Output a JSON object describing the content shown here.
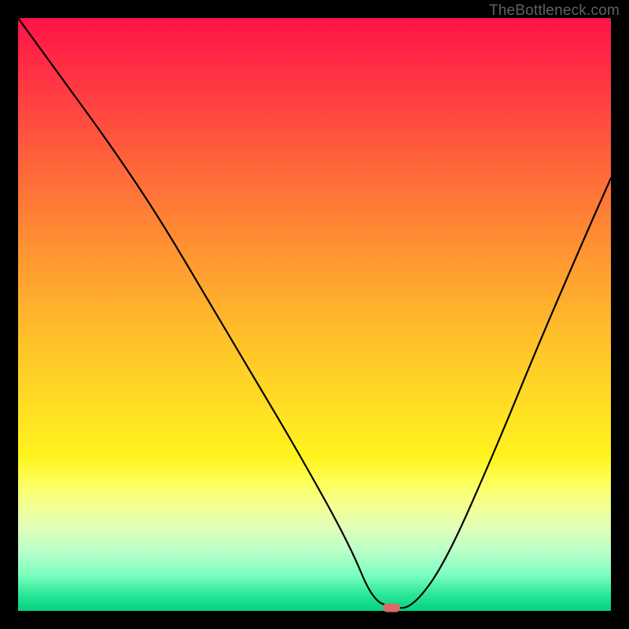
{
  "watermark": "TheBottleneck.com",
  "marker": {
    "x_frac": 0.63,
    "y_frac": 0.995
  },
  "chart_data": {
    "type": "line",
    "title": "",
    "xlabel": "",
    "ylabel": "",
    "xlim": [
      0,
      1
    ],
    "ylim": [
      0,
      1
    ],
    "series": [
      {
        "name": "curve",
        "x": [
          0.0,
          0.08,
          0.16,
          0.24,
          0.32,
          0.4,
          0.48,
          0.56,
          0.597,
          0.63,
          0.665,
          0.72,
          0.8,
          0.88,
          0.96,
          1.0
        ],
        "y": [
          1.0,
          0.89,
          0.78,
          0.66,
          0.525,
          0.39,
          0.255,
          0.11,
          0.02,
          0.005,
          0.005,
          0.08,
          0.26,
          0.455,
          0.64,
          0.73
        ]
      }
    ],
    "background_gradient": {
      "top": "#ff1348",
      "middle": "#ffdd24",
      "bottom": "#00d27f"
    },
    "marker_point": {
      "x": 0.63,
      "y": 0.005,
      "color": "#d86a6a"
    }
  }
}
